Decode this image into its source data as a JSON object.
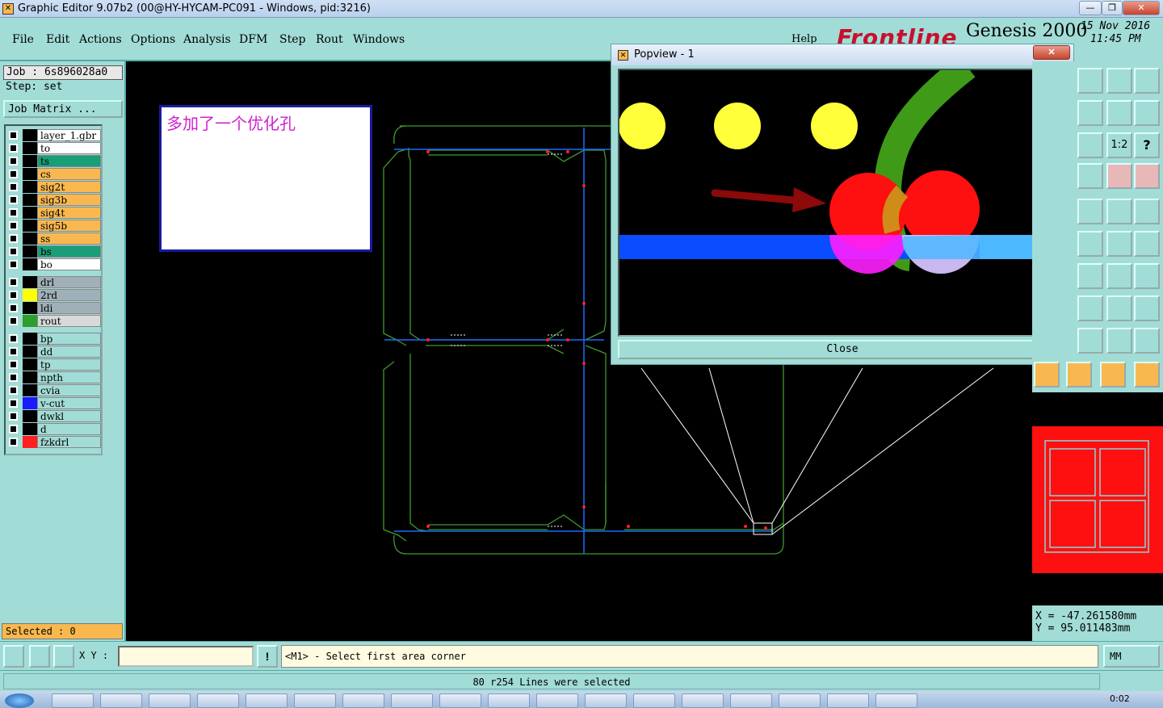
{
  "window": {
    "title": "Graphic Editor 9.07b2 (00@HY-HYCAM-PC091 - Windows, pid:3216)",
    "minimize": "—",
    "restore": "❐",
    "close": "✕"
  },
  "menu": {
    "items": [
      "File",
      "Edit",
      "Actions",
      "Options",
      "Analysis",
      "DFM",
      "Step",
      "Rout",
      "Windows"
    ],
    "help": "Help"
  },
  "brand": {
    "logo": "Frontline",
    "product": "Genesis 2000",
    "date": "15 Nov 2016",
    "time": "11:45 PM"
  },
  "job": {
    "job_label": "Job  :  6s896028a0",
    "step_label": "Step: set",
    "matrix_button": "Job Matrix ..."
  },
  "layers": [
    {
      "name": "layer_1.gbr",
      "bg": "#ffffff",
      "color": "#000000",
      "arrow": "⇕"
    },
    {
      "name": "to",
      "bg": "#ffffff",
      "color": "#000000"
    },
    {
      "name": "ts",
      "bg": "#1a9e77",
      "color": "#000000"
    },
    {
      "name": "cs",
      "bg": "#f9b84f",
      "color": "#000000"
    },
    {
      "name": "sig2t",
      "bg": "#f9b84f",
      "color": "#000000"
    },
    {
      "name": "sig3b",
      "bg": "#f9b84f",
      "color": "#000000"
    },
    {
      "name": "sig4t",
      "bg": "#f9b84f",
      "color": "#000000"
    },
    {
      "name": "sig5b",
      "bg": "#f9b84f",
      "color": "#000000"
    },
    {
      "name": "ss",
      "bg": "#f9b84f",
      "color": "#000000"
    },
    {
      "name": "bs",
      "bg": "#1a9e77",
      "color": "#000000"
    },
    {
      "name": "bo",
      "bg": "#ffffff",
      "color": "#000000"
    },
    {
      "name": "drl",
      "bg": "#9fb0b8",
      "color": "#000000"
    },
    {
      "name": "2rd",
      "bg": "#9fb0b8",
      "color": "#ffff00"
    },
    {
      "name": "ldi",
      "bg": "#9fb0b8",
      "color": "#000000"
    },
    {
      "name": "rout",
      "bg": "#d9d9d9",
      "color": "#2e9e2e"
    },
    {
      "name": "bp",
      "bg": "#a2dcd6",
      "color": "#000000"
    },
    {
      "name": "dd",
      "bg": "#a2dcd6",
      "color": "#000000"
    },
    {
      "name": "tp",
      "bg": "#a2dcd6",
      "color": "#000000"
    },
    {
      "name": "npth",
      "bg": "#a2dcd6",
      "color": "#000000"
    },
    {
      "name": "cvia",
      "bg": "#a2dcd6",
      "color": "#000000"
    },
    {
      "name": "v-cut",
      "bg": "#a2dcd6",
      "color": "#1a1aff"
    },
    {
      "name": "dwkl",
      "bg": "#a2dcd6",
      "color": "#000000"
    },
    {
      "name": "d",
      "bg": "#a2dcd6",
      "color": "#000000"
    },
    {
      "name": "fzkdrl",
      "bg": "#a2dcd6",
      "color": "#ff2020"
    }
  ],
  "selected": "Selected : 0",
  "note": {
    "text": "多加了一个优化孔"
  },
  "popview": {
    "title": "Popview - 1",
    "close_label": "Close"
  },
  "coords": {
    "x": "X  =  -47.261580mm",
    "y": "Y  =  95.011483mm"
  },
  "bottom": {
    "xy_label": "X Y :",
    "xy_value": "",
    "prompt": "<M1> - Select first area corner",
    "units": "MM"
  },
  "status": "80 r254 Lines were selected",
  "taskbar": {
    "clock": "0:02"
  },
  "colors": {
    "panel": "#a2dcd6",
    "highlight": "#f9b84f",
    "board_outline": "#3f9a2a",
    "vcut": "#1a6cff"
  }
}
